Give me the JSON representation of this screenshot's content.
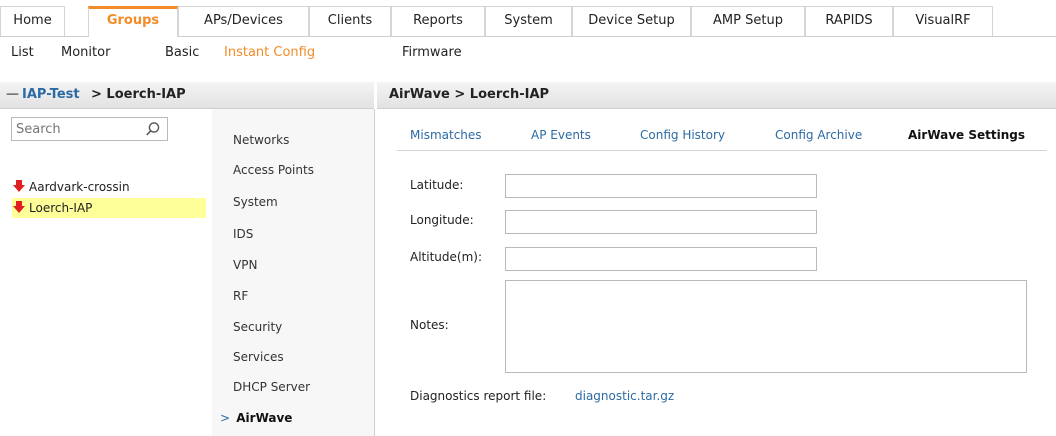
{
  "top_tabs": [
    {
      "label": "Home"
    },
    {
      "label": "Groups",
      "active": true
    },
    {
      "label": "APs/Devices"
    },
    {
      "label": "Clients"
    },
    {
      "label": "Reports"
    },
    {
      "label": "System"
    },
    {
      "label": "Device Setup"
    },
    {
      "label": "AMP Setup"
    },
    {
      "label": "RAPIDS"
    },
    {
      "label": "VisualRF"
    }
  ],
  "sub_nav": [
    {
      "label": "List"
    },
    {
      "label": "Monitor"
    },
    {
      "label": "Basic"
    },
    {
      "label": "Instant Config",
      "active": true
    },
    {
      "label": "Firmware"
    }
  ],
  "left_header": {
    "collapse_glyph": "—",
    "group_link": "IAP-Test",
    "rest": " > Loerch-IAP"
  },
  "search": {
    "placeholder": "Search"
  },
  "tree": [
    {
      "label": "Aardvark-crossin",
      "icon": "red-down-arrow-icon"
    },
    {
      "label": "Loerch-IAP",
      "icon": "red-down-arrow-icon",
      "selected": true
    }
  ],
  "settings_nav": [
    {
      "label": "Networks"
    },
    {
      "label": "Access Points"
    },
    {
      "label": "System"
    },
    {
      "label": "IDS"
    },
    {
      "label": "VPN"
    },
    {
      "label": "RF"
    },
    {
      "label": "Security"
    },
    {
      "label": "Services"
    },
    {
      "label": "DHCP Server"
    },
    {
      "label": "AirWave",
      "current": true,
      "marker": ">"
    }
  ],
  "right_header": {
    "title": "AirWave > Loerch-IAP"
  },
  "sub_tabs": [
    {
      "label": "Mismatches"
    },
    {
      "label": "AP Events"
    },
    {
      "label": "Config History"
    },
    {
      "label": "Config Archive"
    },
    {
      "label": "AirWave Settings",
      "active": true
    }
  ],
  "form": {
    "latitude_label": "Latitude:",
    "latitude_value": "",
    "longitude_label": "Longitude:",
    "longitude_value": "",
    "altitude_label": "Altitude(m):",
    "altitude_value": "",
    "notes_label": "Notes:",
    "notes_value": ""
  },
  "diagnostics": {
    "label": "Diagnostics report file:",
    "link": "diagnostic.tar.gz"
  },
  "colors": {
    "accent": "#f28c28",
    "link": "#2d6aa3",
    "selected_row": "#ffff99",
    "tree_icon": "#e02020"
  }
}
